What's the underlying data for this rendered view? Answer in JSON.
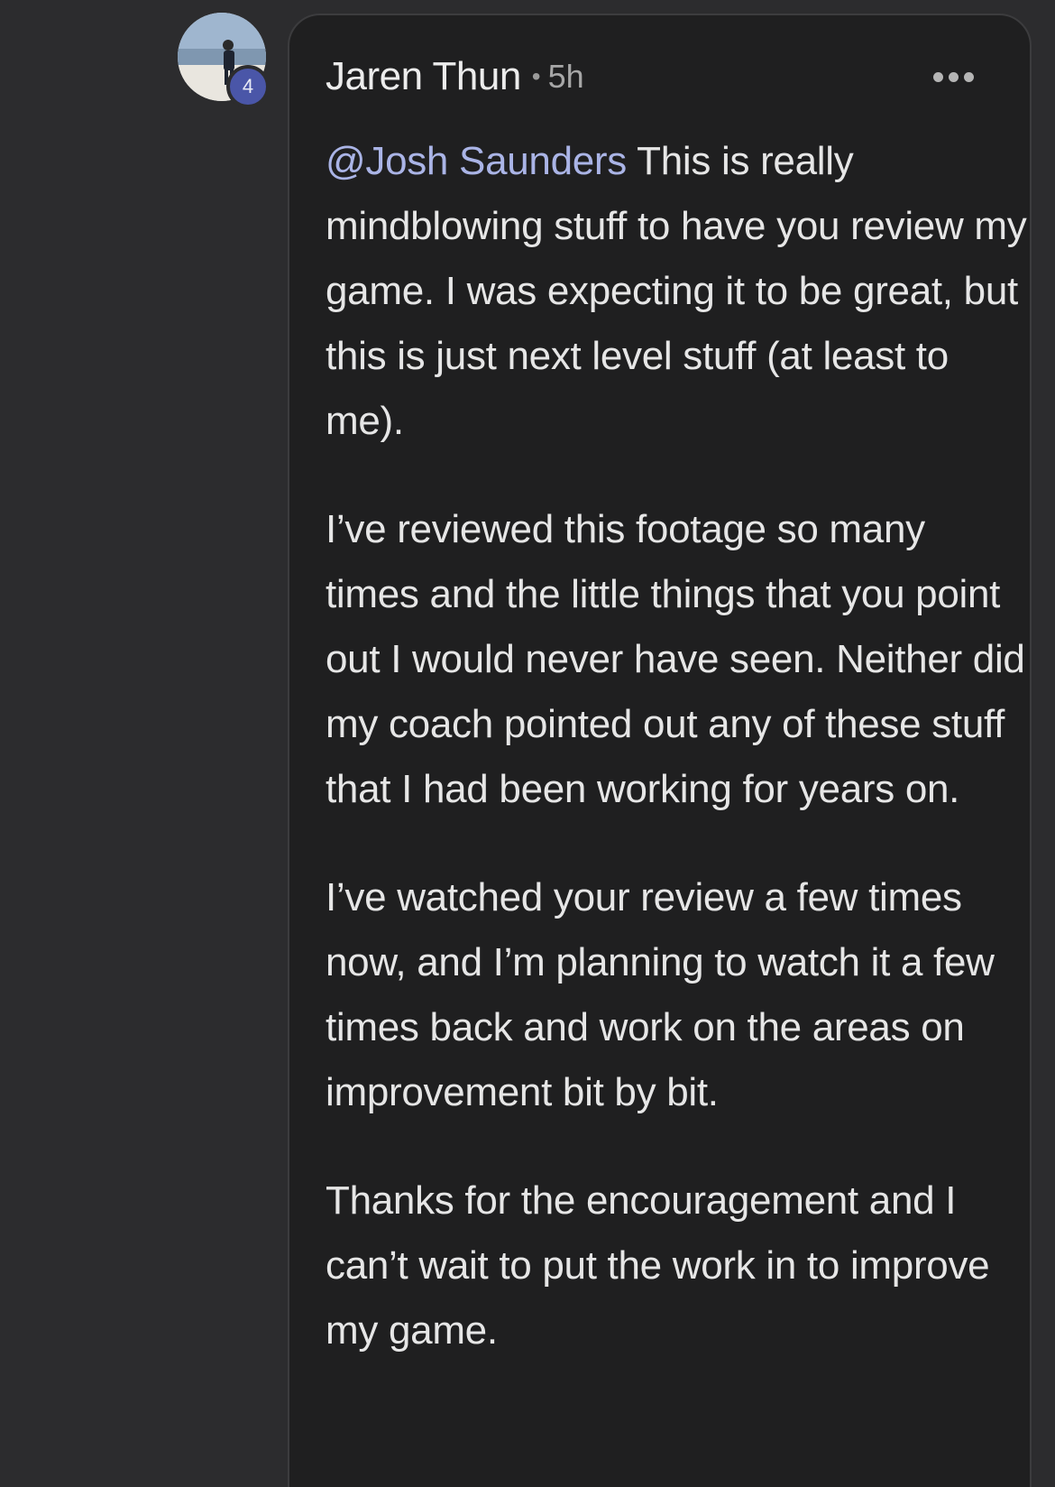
{
  "avatar": {
    "badge_count": "4",
    "icon": "user-avatar"
  },
  "comment": {
    "author": "Jaren Thun",
    "separator": "•",
    "time": "5h",
    "more_icon": "more-horizontal-icon",
    "mention": "@Josh Saunders",
    "paragraphs": [
      " This is really mindblowing stuff to have you review my game. I was expecting it to be great, but this is just next level stuff (at least to me).",
      "I’ve reviewed this footage so many times and the little things that you point out I would never have seen. Neither did my coach pointed out any of these stuff that I had been working for years on.",
      "I’ve watched your review a few times now, and I’m planning to watch it a few times back and work on the areas on improvement bit by bit.",
      "Thanks for the encouragement and I can’t wait to put the work in to improve my game."
    ]
  },
  "colors": {
    "background": "#2c2c2e",
    "card": "#1f1f20",
    "mention": "#aab4e6",
    "badge": "#4a56a8"
  }
}
